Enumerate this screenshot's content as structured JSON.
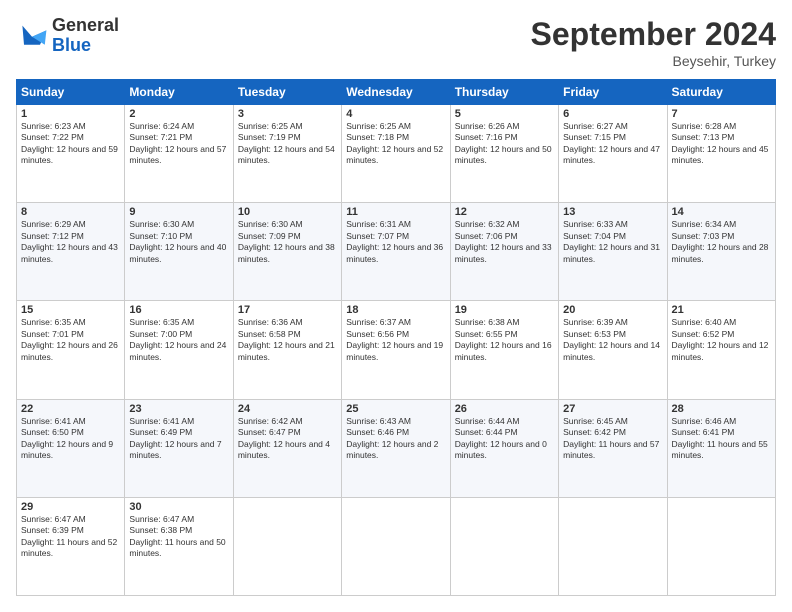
{
  "logo": {
    "line1": "General",
    "line2": "Blue"
  },
  "title": "September 2024",
  "location": "Beysehir, Turkey",
  "headers": [
    "Sunday",
    "Monday",
    "Tuesday",
    "Wednesday",
    "Thursday",
    "Friday",
    "Saturday"
  ],
  "weeks": [
    [
      {
        "day": "1",
        "sunrise": "Sunrise: 6:23 AM",
        "sunset": "Sunset: 7:22 PM",
        "daylight": "Daylight: 12 hours and 59 minutes."
      },
      {
        "day": "2",
        "sunrise": "Sunrise: 6:24 AM",
        "sunset": "Sunset: 7:21 PM",
        "daylight": "Daylight: 12 hours and 57 minutes."
      },
      {
        "day": "3",
        "sunrise": "Sunrise: 6:25 AM",
        "sunset": "Sunset: 7:19 PM",
        "daylight": "Daylight: 12 hours and 54 minutes."
      },
      {
        "day": "4",
        "sunrise": "Sunrise: 6:25 AM",
        "sunset": "Sunset: 7:18 PM",
        "daylight": "Daylight: 12 hours and 52 minutes."
      },
      {
        "day": "5",
        "sunrise": "Sunrise: 6:26 AM",
        "sunset": "Sunset: 7:16 PM",
        "daylight": "Daylight: 12 hours and 50 minutes."
      },
      {
        "day": "6",
        "sunrise": "Sunrise: 6:27 AM",
        "sunset": "Sunset: 7:15 PM",
        "daylight": "Daylight: 12 hours and 47 minutes."
      },
      {
        "day": "7",
        "sunrise": "Sunrise: 6:28 AM",
        "sunset": "Sunset: 7:13 PM",
        "daylight": "Daylight: 12 hours and 45 minutes."
      }
    ],
    [
      {
        "day": "8",
        "sunrise": "Sunrise: 6:29 AM",
        "sunset": "Sunset: 7:12 PM",
        "daylight": "Daylight: 12 hours and 43 minutes."
      },
      {
        "day": "9",
        "sunrise": "Sunrise: 6:30 AM",
        "sunset": "Sunset: 7:10 PM",
        "daylight": "Daylight: 12 hours and 40 minutes."
      },
      {
        "day": "10",
        "sunrise": "Sunrise: 6:30 AM",
        "sunset": "Sunset: 7:09 PM",
        "daylight": "Daylight: 12 hours and 38 minutes."
      },
      {
        "day": "11",
        "sunrise": "Sunrise: 6:31 AM",
        "sunset": "Sunset: 7:07 PM",
        "daylight": "Daylight: 12 hours and 36 minutes."
      },
      {
        "day": "12",
        "sunrise": "Sunrise: 6:32 AM",
        "sunset": "Sunset: 7:06 PM",
        "daylight": "Daylight: 12 hours and 33 minutes."
      },
      {
        "day": "13",
        "sunrise": "Sunrise: 6:33 AM",
        "sunset": "Sunset: 7:04 PM",
        "daylight": "Daylight: 12 hours and 31 minutes."
      },
      {
        "day": "14",
        "sunrise": "Sunrise: 6:34 AM",
        "sunset": "Sunset: 7:03 PM",
        "daylight": "Daylight: 12 hours and 28 minutes."
      }
    ],
    [
      {
        "day": "15",
        "sunrise": "Sunrise: 6:35 AM",
        "sunset": "Sunset: 7:01 PM",
        "daylight": "Daylight: 12 hours and 26 minutes."
      },
      {
        "day": "16",
        "sunrise": "Sunrise: 6:35 AM",
        "sunset": "Sunset: 7:00 PM",
        "daylight": "Daylight: 12 hours and 24 minutes."
      },
      {
        "day": "17",
        "sunrise": "Sunrise: 6:36 AM",
        "sunset": "Sunset: 6:58 PM",
        "daylight": "Daylight: 12 hours and 21 minutes."
      },
      {
        "day": "18",
        "sunrise": "Sunrise: 6:37 AM",
        "sunset": "Sunset: 6:56 PM",
        "daylight": "Daylight: 12 hours and 19 minutes."
      },
      {
        "day": "19",
        "sunrise": "Sunrise: 6:38 AM",
        "sunset": "Sunset: 6:55 PM",
        "daylight": "Daylight: 12 hours and 16 minutes."
      },
      {
        "day": "20",
        "sunrise": "Sunrise: 6:39 AM",
        "sunset": "Sunset: 6:53 PM",
        "daylight": "Daylight: 12 hours and 14 minutes."
      },
      {
        "day": "21",
        "sunrise": "Sunrise: 6:40 AM",
        "sunset": "Sunset: 6:52 PM",
        "daylight": "Daylight: 12 hours and 12 minutes."
      }
    ],
    [
      {
        "day": "22",
        "sunrise": "Sunrise: 6:41 AM",
        "sunset": "Sunset: 6:50 PM",
        "daylight": "Daylight: 12 hours and 9 minutes."
      },
      {
        "day": "23",
        "sunrise": "Sunrise: 6:41 AM",
        "sunset": "Sunset: 6:49 PM",
        "daylight": "Daylight: 12 hours and 7 minutes."
      },
      {
        "day": "24",
        "sunrise": "Sunrise: 6:42 AM",
        "sunset": "Sunset: 6:47 PM",
        "daylight": "Daylight: 12 hours and 4 minutes."
      },
      {
        "day": "25",
        "sunrise": "Sunrise: 6:43 AM",
        "sunset": "Sunset: 6:46 PM",
        "daylight": "Daylight: 12 hours and 2 minutes."
      },
      {
        "day": "26",
        "sunrise": "Sunrise: 6:44 AM",
        "sunset": "Sunset: 6:44 PM",
        "daylight": "Daylight: 12 hours and 0 minutes."
      },
      {
        "day": "27",
        "sunrise": "Sunrise: 6:45 AM",
        "sunset": "Sunset: 6:42 PM",
        "daylight": "Daylight: 11 hours and 57 minutes."
      },
      {
        "day": "28",
        "sunrise": "Sunrise: 6:46 AM",
        "sunset": "Sunset: 6:41 PM",
        "daylight": "Daylight: 11 hours and 55 minutes."
      }
    ],
    [
      {
        "day": "29",
        "sunrise": "Sunrise: 6:47 AM",
        "sunset": "Sunset: 6:39 PM",
        "daylight": "Daylight: 11 hours and 52 minutes."
      },
      {
        "day": "30",
        "sunrise": "Sunrise: 6:47 AM",
        "sunset": "Sunset: 6:38 PM",
        "daylight": "Daylight: 11 hours and 50 minutes."
      },
      null,
      null,
      null,
      null,
      null
    ]
  ]
}
